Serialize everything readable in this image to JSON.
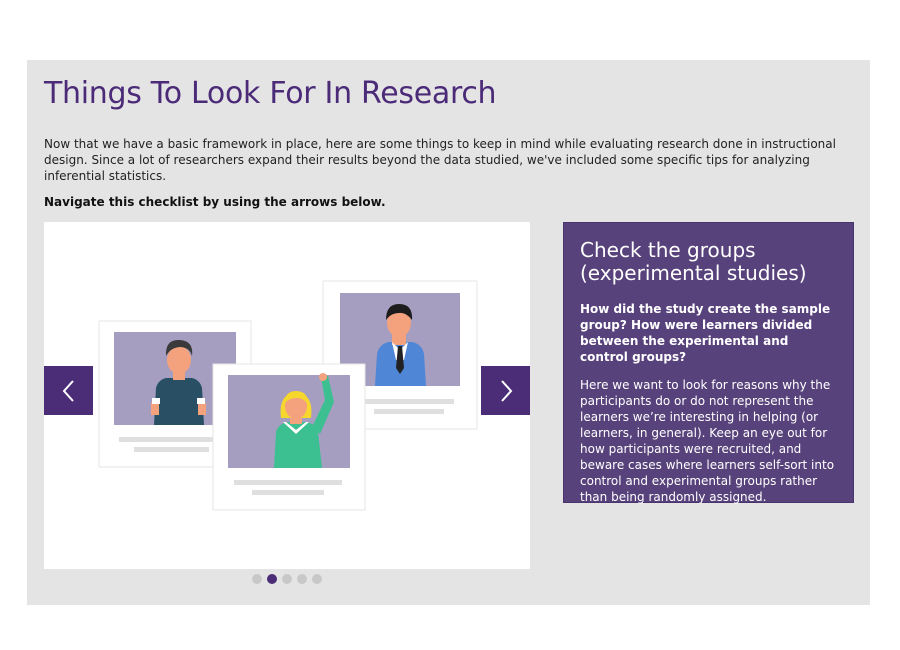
{
  "title": "Things To Look For In Research",
  "intro": "Now that we have a basic framework in place, here are some things to keep in mind while evaluating research done in instructional design. Since a lot of researchers expand their results beyond the data studied, we've included some specific tips for analyzing inferential statistics.",
  "nav_hint": "Navigate this checklist by using the arrows below.",
  "carousel": {
    "prev_icon": "chevron-left-icon",
    "next_icon": "chevron-right-icon",
    "dot_count": 5,
    "active_index": 1
  },
  "card": {
    "heading": "Check the groups (experimental studies)",
    "question": "How did the study create the sample group? How were learners divided between the experimental and control groups?",
    "body": "Here we want to look for reasons why the participants do or do not represent the learners we’re interesting in helping (or learners, in general). Keep an eye out for how participants were recruited, and beware cases where learners self-sort into control and experimental groups rather than being randomly assigned."
  },
  "colors": {
    "accent": "#4b2d77",
    "card_bg": "#58427c",
    "panel_bg": "#e4e4e5",
    "photo_bg": "#a69ec0"
  }
}
